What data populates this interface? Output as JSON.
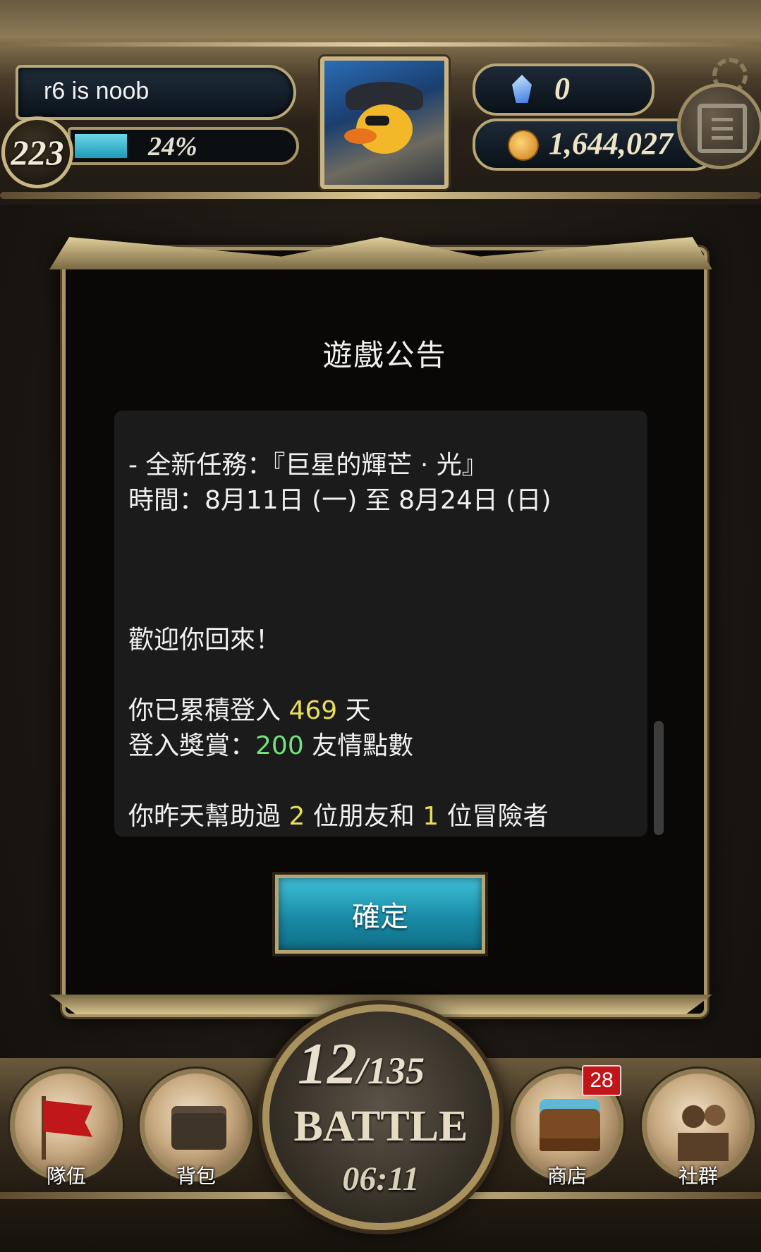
{
  "player": {
    "name": "r6 is noob",
    "level": "223",
    "exp_percent_label": "24%",
    "exp_progress": 0.24
  },
  "currency": {
    "gems": "0",
    "coins": "1,644,027"
  },
  "dialog": {
    "title": "遊戲公告",
    "lines": {
      "quest": " - 全新任務：『巨星的輝芒 · 光』",
      "period": "時間：8月11日 (一) 至 8月24日 (日)",
      "welcome": "歡迎你回來！",
      "login_prefix": "你已累積登入 ",
      "login_days": "469",
      "login_suffix": " 天",
      "reward_prefix": "登入獎賞：",
      "reward_amount": "200",
      "reward_suffix": " 友情點數",
      "help_prefix": "你昨天幫助過 ",
      "help_friends": "2",
      "help_mid": " 位朋友和 ",
      "help_adventurers": "1",
      "help_suffix": " 位冒險者"
    },
    "confirm_label": "確定"
  },
  "battle": {
    "stamina_current": "12",
    "stamina_max": "/135",
    "label": "BATTLE",
    "timer": "06:11"
  },
  "nav": {
    "team": "隊伍",
    "bag": "背包",
    "shop": "商店",
    "shop_badge": "28",
    "social": "社群"
  },
  "colors": {
    "highlight_yellow": "#e9dd5a",
    "highlight_green": "#72e37a",
    "confirm_button": "#1a8ba6",
    "exp_bar": "#1e9ab7"
  }
}
